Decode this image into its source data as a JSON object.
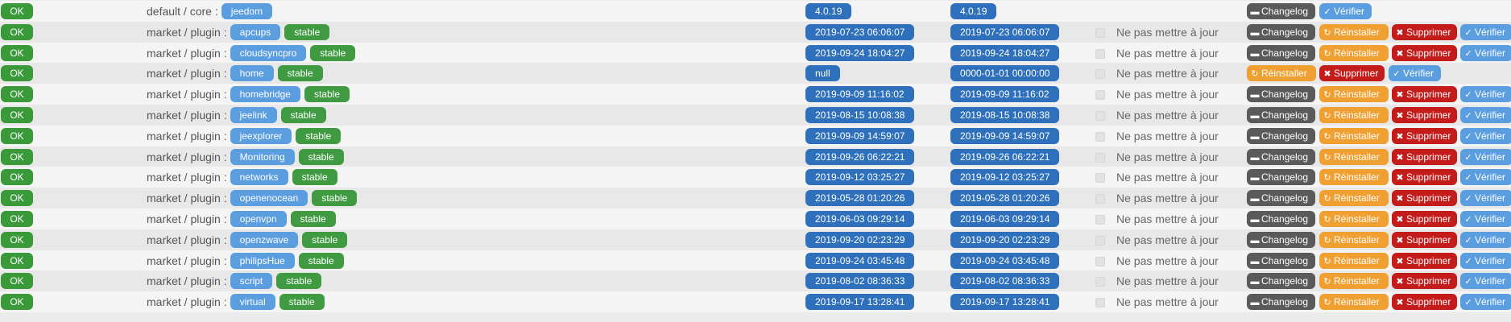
{
  "labels": {
    "ok": "OK",
    "stable": "stable",
    "no_update": "Ne pas mettre à jour",
    "changelog": "Changelog",
    "reinstall": "Réinstaller",
    "delete": "Supprimer",
    "verify": "Vérifier"
  },
  "colors": {
    "ok": "#3a9a3a",
    "name": "#5b9ee0",
    "stable": "#3f9a41",
    "date": "#2e70bb",
    "changelog": "#5a5a5a",
    "reinstall": "#f0a030",
    "delete": "#c41b1b",
    "verify": "#5b9ee0"
  },
  "icons": {
    "changelog": "book-icon",
    "reinstall": "refresh-icon",
    "delete": "trash-icon",
    "verify": "check-icon"
  },
  "rows": [
    {
      "source": "default / core :",
      "name": "jeedom",
      "branch": "",
      "local_version": "4.0.19",
      "remote_version": "4.0.19",
      "no_update": false,
      "actions": [
        "changelog",
        "verify"
      ]
    },
    {
      "source": "market / plugin :",
      "name": "apcups",
      "branch": "stable",
      "local_version": "2019-07-23 06:06:07",
      "remote_version": "2019-07-23 06:06:07",
      "no_update": true,
      "actions": [
        "changelog",
        "reinstall",
        "delete",
        "verify"
      ]
    },
    {
      "source": "market / plugin :",
      "name": "cloudsyncpro",
      "branch": "stable",
      "local_version": "2019-09-24 18:04:27",
      "remote_version": "2019-09-24 18:04:27",
      "no_update": true,
      "actions": [
        "changelog",
        "reinstall",
        "delete",
        "verify"
      ]
    },
    {
      "source": "market / plugin :",
      "name": "home",
      "branch": "stable",
      "local_version": "null",
      "remote_version": "0000-01-01 00:00:00",
      "no_update": true,
      "actions": [
        "reinstall",
        "delete",
        "verify"
      ]
    },
    {
      "source": "market / plugin :",
      "name": "homebridge",
      "branch": "stable",
      "local_version": "2019-09-09 11:16:02",
      "remote_version": "2019-09-09 11:16:02",
      "no_update": true,
      "actions": [
        "changelog",
        "reinstall",
        "delete",
        "verify"
      ]
    },
    {
      "source": "market / plugin :",
      "name": "jeelink",
      "branch": "stable",
      "local_version": "2019-08-15 10:08:38",
      "remote_version": "2019-08-15 10:08:38",
      "no_update": true,
      "actions": [
        "changelog",
        "reinstall",
        "delete",
        "verify"
      ]
    },
    {
      "source": "market / plugin :",
      "name": "jeexplorer",
      "branch": "stable",
      "local_version": "2019-09-09 14:59:07",
      "remote_version": "2019-09-09 14:59:07",
      "no_update": true,
      "actions": [
        "changelog",
        "reinstall",
        "delete",
        "verify"
      ]
    },
    {
      "source": "market / plugin :",
      "name": "Monitoring",
      "branch": "stable",
      "local_version": "2019-09-26 06:22:21",
      "remote_version": "2019-09-26 06:22:21",
      "no_update": true,
      "actions": [
        "changelog",
        "reinstall",
        "delete",
        "verify"
      ]
    },
    {
      "source": "market / plugin :",
      "name": "networks",
      "branch": "stable",
      "local_version": "2019-09-12 03:25:27",
      "remote_version": "2019-09-12 03:25:27",
      "no_update": true,
      "actions": [
        "changelog",
        "reinstall",
        "delete",
        "verify"
      ]
    },
    {
      "source": "market / plugin :",
      "name": "openenocean",
      "branch": "stable",
      "local_version": "2019-05-28 01:20:26",
      "remote_version": "2019-05-28 01:20:26",
      "no_update": true,
      "actions": [
        "changelog",
        "reinstall",
        "delete",
        "verify"
      ]
    },
    {
      "source": "market / plugin :",
      "name": "openvpn",
      "branch": "stable",
      "local_version": "2019-06-03 09:29:14",
      "remote_version": "2019-06-03 09:29:14",
      "no_update": true,
      "actions": [
        "changelog",
        "reinstall",
        "delete",
        "verify"
      ]
    },
    {
      "source": "market / plugin :",
      "name": "openzwave",
      "branch": "stable",
      "local_version": "2019-09-20 02:23:29",
      "remote_version": "2019-09-20 02:23:29",
      "no_update": true,
      "actions": [
        "changelog",
        "reinstall",
        "delete",
        "verify"
      ]
    },
    {
      "source": "market / plugin :",
      "name": "philipsHue",
      "branch": "stable",
      "local_version": "2019-09-24 03:45:48",
      "remote_version": "2019-09-24 03:45:48",
      "no_update": true,
      "actions": [
        "changelog",
        "reinstall",
        "delete",
        "verify"
      ]
    },
    {
      "source": "market / plugin :",
      "name": "script",
      "branch": "stable",
      "local_version": "2019-08-02 08:36:33",
      "remote_version": "2019-08-02 08:36:33",
      "no_update": true,
      "actions": [
        "changelog",
        "reinstall",
        "delete",
        "verify"
      ]
    },
    {
      "source": "market / plugin :",
      "name": "virtual",
      "branch": "stable",
      "local_version": "2019-09-17 13:28:41",
      "remote_version": "2019-09-17 13:28:41",
      "no_update": true,
      "actions": [
        "changelog",
        "reinstall",
        "delete",
        "verify"
      ]
    }
  ]
}
